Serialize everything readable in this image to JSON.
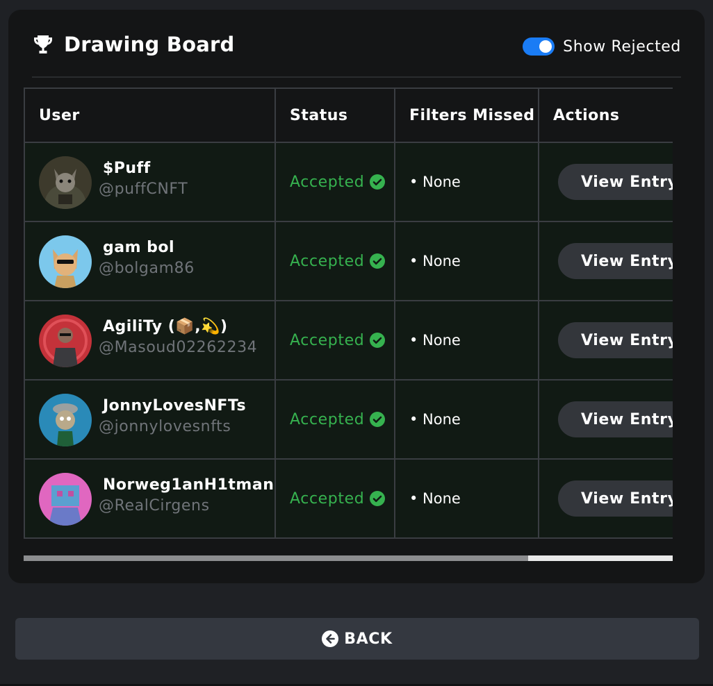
{
  "header": {
    "title": "Drawing Board",
    "trophy_icon": "trophy-icon",
    "toggle_label": "Show Rejected",
    "toggle_on": true
  },
  "table": {
    "columns": [
      "User",
      "Status",
      "Filters Missed",
      "Actions"
    ],
    "rows": [
      {
        "name": "$Puff",
        "handle": "@puffCNFT",
        "status": "Accepted",
        "filters": "• None",
        "action": "View Entry"
      },
      {
        "name": "gam bol",
        "handle": "@bolgam86",
        "status": "Accepted",
        "filters": "• None",
        "action": "View Entry"
      },
      {
        "name": "AgiliTy (📦,💫)",
        "handle": "@Masoud02262234",
        "status": "Accepted",
        "filters": "• None",
        "action": "View Entry"
      },
      {
        "name": "JonnyLovesNFTs",
        "handle": "@jonnylovesnfts",
        "status": "Accepted",
        "filters": "• None",
        "action": "View Entry"
      },
      {
        "name": "Norweg1anH1tman",
        "handle": "@RealCirgens",
        "status": "Accepted",
        "filters": "• None",
        "action": "View Entry"
      }
    ]
  },
  "back": {
    "label": "BACK",
    "icon": "arrow-left-circle-icon"
  },
  "colors": {
    "accent": "#1a7cf5",
    "accepted": "#36b24f",
    "card_bg": "#141516",
    "row_bg": "#111a14",
    "button_bg": "#33363b"
  }
}
